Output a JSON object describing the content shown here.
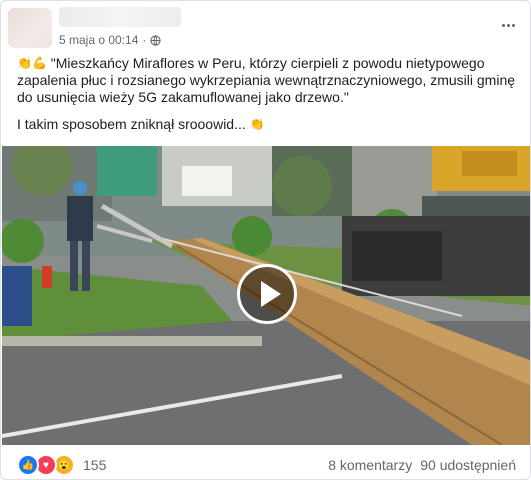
{
  "post": {
    "timestamp": "5 maja o 00:14",
    "separator": "·",
    "paragraph1_line1": "\"Mieszkańcy Miraflores w Peru, którzy cierpieli z powodu nietypowego",
    "paragraph1_line2": "zapalenia płuc i rozsianego wykrzepiania wewnątrznaczyniowego, zmusili gminę",
    "paragraph1_line3": "do usunięcia wieży 5G zakamuflowanej jako drzewo.\"",
    "paragraph2": "I takim sposobem zniknął srooowid...",
    "emoji_clap": "👏",
    "emoji_muscle": "💪"
  },
  "reactions": {
    "like_icon": "👍",
    "love_icon": "♥",
    "wow_icon": "😮",
    "count": "155"
  },
  "stats": {
    "comments": "8 komentarzy",
    "shares": "90 udostępnień"
  },
  "icons": {
    "globe": "globe-icon",
    "more": "more-options-icon",
    "play": "play-icon"
  },
  "colors": {
    "like": "#1877f2",
    "love": "#f33e58",
    "wow": "#f7b125",
    "meta_text": "#65676b"
  }
}
